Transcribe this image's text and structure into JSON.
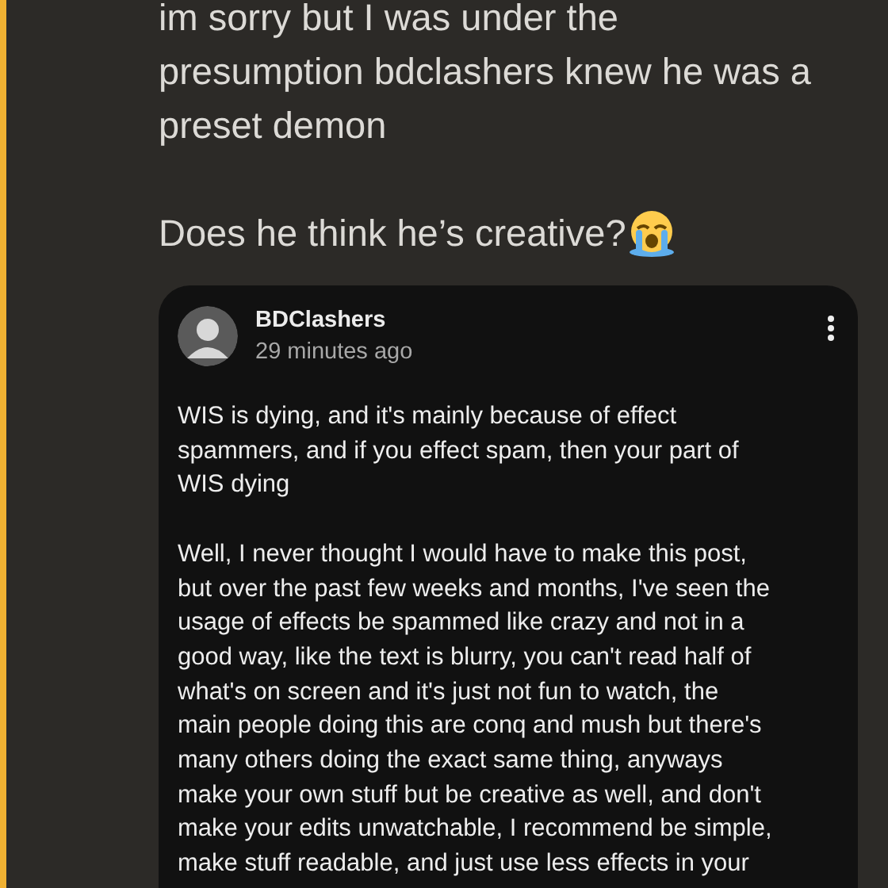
{
  "message": {
    "lines": [
      "im sorry but I was under the",
      "presumption bdclashers knew he was a",
      "preset demon"
    ],
    "question": "Does he think he’s creative?"
  },
  "embed": {
    "author": "BDClashers",
    "time": "29 minutes ago",
    "paragraphs": [
      [
        "WIS is dying, and it's mainly because of effect",
        "spammers, and if you effect spam, then your part of",
        "WIS dying"
      ],
      [
        "Well, I never thought I would have to make this post,",
        "but over the past few weeks and months, I've seen the",
        "usage of effects be spammed like crazy and not in a",
        "good way, like the text is blurry, you can't read half of",
        "what's on screen and it's just not fun to watch, the",
        "main people doing this are conq and mush but there's",
        "many others doing the exact same thing, anyways",
        "make your own stuff but be creative as well, and don't",
        "make your edits unwatchable, I recommend be simple,",
        "make stuff readable, and just use less effects in your"
      ]
    ]
  }
}
